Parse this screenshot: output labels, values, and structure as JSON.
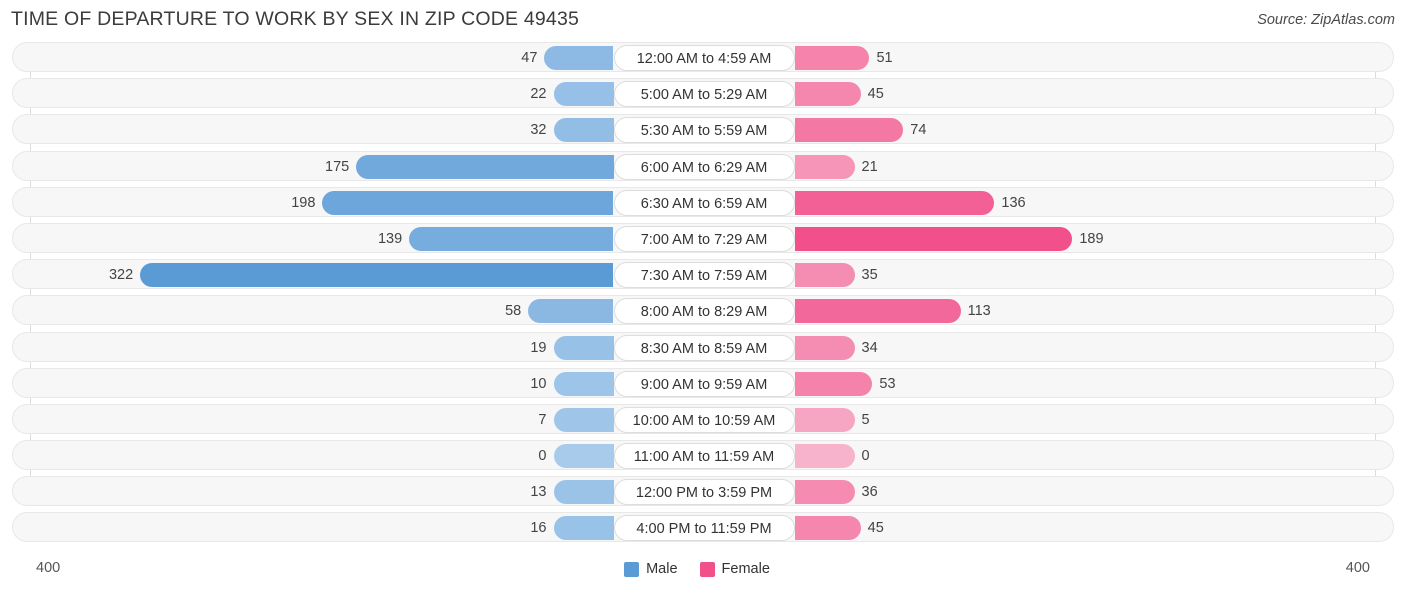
{
  "header": {
    "title": "TIME OF DEPARTURE TO WORK BY SEX IN ZIP CODE 49435",
    "source": "Source: ZipAtlas.com"
  },
  "legend": {
    "male_label": "Male",
    "female_label": "Female",
    "male_color": "#5b9bd5",
    "female_color": "#f2508a"
  },
  "axis": {
    "left_label": "400",
    "right_label": "400",
    "max": 400
  },
  "chart_data": {
    "type": "bar",
    "subtype": "diverging-butterfly",
    "title": "TIME OF DEPARTURE TO WORK BY SEX IN ZIP CODE 49435",
    "xlabel": "",
    "ylabel": "",
    "xlim": [
      400,
      400
    ],
    "grid": true,
    "legend_position": "bottom-center",
    "categories": [
      "12:00 AM to 4:59 AM",
      "5:00 AM to 5:29 AM",
      "5:30 AM to 5:59 AM",
      "6:00 AM to 6:29 AM",
      "6:30 AM to 6:59 AM",
      "7:00 AM to 7:29 AM",
      "7:30 AM to 7:59 AM",
      "8:00 AM to 8:29 AM",
      "8:30 AM to 8:59 AM",
      "9:00 AM to 9:59 AM",
      "10:00 AM to 10:59 AM",
      "11:00 AM to 11:59 AM",
      "12:00 PM to 3:59 PM",
      "4:00 PM to 11:59 PM"
    ],
    "series": [
      {
        "name": "Male",
        "color": "#5b9bd5",
        "values": [
          47,
          22,
          32,
          175,
          198,
          139,
          322,
          58,
          19,
          10,
          7,
          0,
          13,
          16
        ]
      },
      {
        "name": "Female",
        "color": "#f2508a",
        "values": [
          51,
          45,
          74,
          21,
          136,
          189,
          35,
          113,
          34,
          53,
          5,
          0,
          36,
          45
        ]
      }
    ]
  },
  "rows": [
    {
      "label": "12:00 AM to 4:59 AM",
      "male": 47,
      "female": 51
    },
    {
      "label": "5:00 AM to 5:29 AM",
      "male": 22,
      "female": 45
    },
    {
      "label": "5:30 AM to 5:59 AM",
      "male": 32,
      "female": 74
    },
    {
      "label": "6:00 AM to 6:29 AM",
      "male": 175,
      "female": 21
    },
    {
      "label": "6:30 AM to 6:59 AM",
      "male": 198,
      "female": 136
    },
    {
      "label": "7:00 AM to 7:29 AM",
      "male": 139,
      "female": 189
    },
    {
      "label": "7:30 AM to 7:59 AM",
      "male": 322,
      "female": 35
    },
    {
      "label": "8:00 AM to 8:29 AM",
      "male": 58,
      "female": 113
    },
    {
      "label": "8:30 AM to 8:59 AM",
      "male": 19,
      "female": 34
    },
    {
      "label": "9:00 AM to 9:59 AM",
      "male": 10,
      "female": 53
    },
    {
      "label": "10:00 AM to 10:59 AM",
      "male": 7,
      "female": 5
    },
    {
      "label": "11:00 AM to 11:59 AM",
      "male": 0,
      "female": 0
    },
    {
      "label": "12:00 PM to 3:59 PM",
      "male": 13,
      "female": 36
    },
    {
      "label": "4:00 PM to 11:59 PM",
      "male": 16,
      "female": 45
    }
  ]
}
